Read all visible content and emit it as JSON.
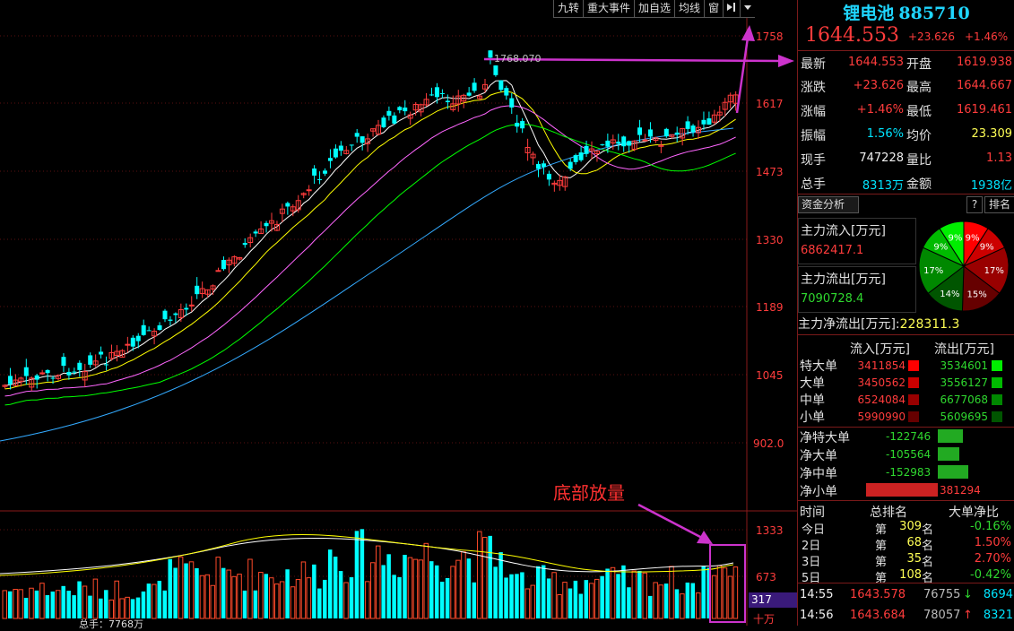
{
  "toolbar": {
    "items": [
      "九转",
      "重大事件",
      "加自选",
      "均线",
      "窗"
    ]
  },
  "chart_annotations": {
    "high_price_label": "1768.070",
    "volume_note": "底部放量",
    "volume_total_label": "总手：7768万"
  },
  "price_axis": {
    "ticks": [
      "1758",
      "1617",
      "1473",
      "1330",
      "1189",
      "1045",
      "902.0"
    ]
  },
  "volume_axis": {
    "ticks": [
      "1333",
      "673"
    ],
    "current": "317",
    "unit": "十万"
  },
  "colors": {
    "up": "#ff3c3c",
    "down": "#00ffff",
    "ma5": "#ffffff",
    "ma10": "#ffff00",
    "ma20": "#ff66ff",
    "ma30": "#00ff00",
    "ma60": "#33aaff",
    "annotation": "#cc33cc"
  },
  "quote": {
    "name": "锂电池",
    "code": "885710",
    "price": "1644.553",
    "change": "+23.626",
    "change_pct": "+1.46%",
    "rows": [
      {
        "l1": "最新",
        "v1": "1644.553",
        "l2": "开盘",
        "v2": "1619.938"
      },
      {
        "l1": "涨跌",
        "v1": "+23.626",
        "l2": "最高",
        "v2": "1644.667"
      },
      {
        "l1": "涨幅",
        "v1": "+1.46%",
        "l2": "最低",
        "v2": "1619.461"
      },
      {
        "l1": "振幅",
        "v1": "1.56%",
        "l2": "均价",
        "v2": "23.309"
      },
      {
        "l1": "现手",
        "v1": "747228",
        "l2": "量比",
        "v2": "1.13"
      },
      {
        "l1": "总手",
        "v1": "8313万",
        "l2": "金额",
        "v2": "1938亿"
      }
    ]
  },
  "fund": {
    "tab_label": "资金分析",
    "tab_help": "?",
    "tab_rank": "排名",
    "inflow_label": "主力流入[万元]",
    "inflow_value": "6862417.1",
    "outflow_label": "主力流出[万元]",
    "outflow_value": "7090728.4",
    "net_label": "主力净流出[万元]:",
    "net_value": "228311.3",
    "pie": [
      {
        "label": "9%",
        "value": 9,
        "color": "#ff0000"
      },
      {
        "label": "9%",
        "value": 9,
        "color": "#cc0000"
      },
      {
        "label": "17%",
        "value": 17,
        "color": "#990000"
      },
      {
        "label": "15%",
        "value": 15,
        "color": "#660000"
      },
      {
        "label": "14%",
        "value": 14,
        "color": "#005500"
      },
      {
        "label": "17%",
        "value": 17,
        "color": "#008800"
      },
      {
        "label": "9%",
        "value": 9,
        "color": "#00bb00"
      },
      {
        "label": "9%",
        "value": 9,
        "color": "#00ee00"
      }
    ],
    "orders_header": {
      "in": "流入[万元]",
      "out": "流出[万元]"
    },
    "orders": [
      {
        "label": "特大单",
        "in": "3411854",
        "out": "3534601"
      },
      {
        "label": "大单",
        "in": "3450562",
        "out": "3556127"
      },
      {
        "label": "中单",
        "in": "6524084",
        "out": "6677068"
      },
      {
        "label": "小单",
        "in": "5990990",
        "out": "5609695"
      }
    ],
    "net_orders": [
      {
        "label": "净特大单",
        "value": "-122746"
      },
      {
        "label": "净大单",
        "value": "-105564"
      },
      {
        "label": "净中单",
        "value": "-152983"
      },
      {
        "label": "净小单",
        "value": "381294"
      }
    ],
    "rank_header": {
      "time": "时间",
      "rank": "总排名",
      "big": "大单净比"
    },
    "ranks": [
      {
        "day": "今日",
        "pre": "第",
        "rank": "309",
        "suf": "名",
        "big": "-0.16%"
      },
      {
        "day": "2日",
        "pre": "第",
        "rank": "68",
        "suf": "名",
        "big": "1.50%"
      },
      {
        "day": "3日",
        "pre": "第",
        "rank": "35",
        "suf": "名",
        "big": "2.70%"
      },
      {
        "day": "5日",
        "pre": "第",
        "rank": "108",
        "suf": "名",
        "big": "-0.42%"
      }
    ]
  },
  "ticks": [
    {
      "time": "14:55",
      "price": "1643.578",
      "vol": "76755",
      "arrow": "↓",
      "amount": "8694"
    },
    {
      "time": "14:56",
      "price": "1643.684",
      "vol": "78057",
      "arrow": "↑",
      "amount": "8321"
    }
  ]
}
